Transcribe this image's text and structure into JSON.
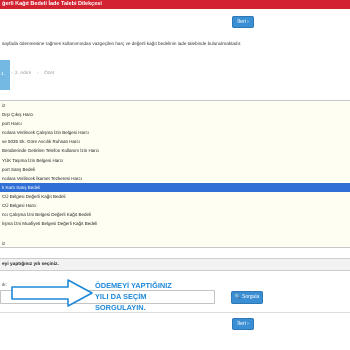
{
  "window": {
    "title": "ğerli Kağıt Bedeli İade Talebi Dilekçesi"
  },
  "buttons": {
    "next_label": "İleri",
    "query_label": "Sorgula"
  },
  "info": {
    "text": "sayfada ödenmesine rağmen kullanımından vazgeçilen harç ve değerli kağıt bedelinin iade talebinde bulunulmaktadır."
  },
  "stepper": {
    "step1": "1.",
    "step2": "2. Adım",
    "step3": "Özet"
  },
  "list": {
    "items": [
      "iz",
      "Dışı Çıkış Harcı",
      "port Harcı",
      "ncılara Verilecek Çalışma İzin Belgesi Harcı",
      "ve 5035 Sk. Göre Avcılık Ruhsatı Harcı",
      "Beraberinde Getirilen Telefon Kullanım İzin Harcı",
      "YÜK Taşıma İzin Belgesi Harcı",
      "port Satış Bedeli",
      "ncılara Verilecek İkamet Tezkeresi Harcı",
      "k Kartı Satış Bedeli",
      "CÜ Belgesi Değerli Kağıt Bedeli",
      "CÜ Belgesi Harcı",
      "ncı Çalışma İzni Belgesi Değerli Kağıt Bedeli",
      "lışma İzni Muafiyeti Belgesi Değerli Kağıt Bedeli"
    ],
    "selected_index": 9,
    "last_line": "iz"
  },
  "section": {
    "title": "eyi yaptığınız yılı seçiniz."
  },
  "year": {
    "label": "ılı:",
    "value": ""
  },
  "annotation": {
    "line1": "ÖDEMEYİ YAPTIĞINIZ",
    "line2": "YILI DA SEÇİM",
    "line3": "SORGULAYIN."
  },
  "colors": {
    "title_bar": "#d32230",
    "button": "#3a8ed4",
    "selected_item": "#2f6fd6",
    "annotation": "#1e88d8",
    "step_active": "#74b9e3"
  },
  "icons": {
    "next": "chevron-right-icon",
    "query": "search-icon"
  }
}
